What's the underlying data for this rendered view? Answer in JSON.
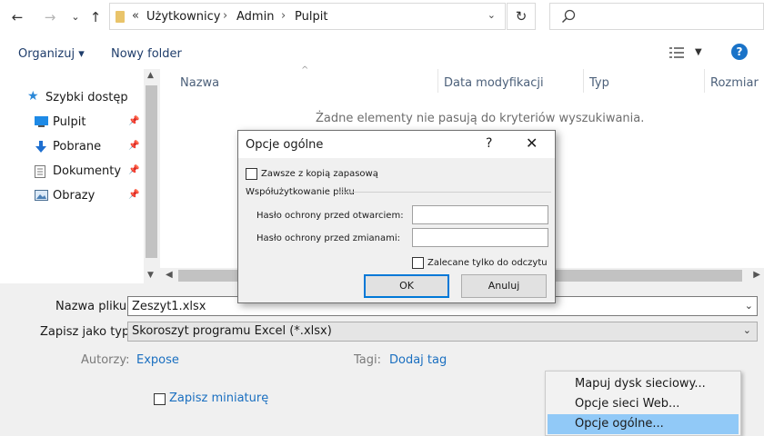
{
  "address": {
    "double_arrow": "«",
    "crumbs": [
      "Użytkownicy",
      "Admin",
      "Pulpit"
    ],
    "sep": "›",
    "dropdown": "⌄"
  },
  "toolbar": {
    "organize_label": "Organizuj",
    "organize_arrow": "▾",
    "new_folder_label": "Nowy folder",
    "help_label": "?"
  },
  "nav_pane": {
    "items": [
      {
        "label": "Szybki dostęp",
        "icon": "star-icon"
      },
      {
        "label": "Pulpit",
        "icon": "desktop-icon"
      },
      {
        "label": "Pobrane",
        "icon": "download-icon"
      },
      {
        "label": "Dokumenty",
        "icon": "document-icon"
      },
      {
        "label": "Obrazy",
        "icon": "pictures-icon"
      }
    ]
  },
  "file_list": {
    "columns": [
      "Nazwa",
      "Data modyfikacji",
      "Typ",
      "Rozmiar"
    ],
    "empty_message": "Żadne elementy nie pasują do kryteriów wyszukiwania."
  },
  "form": {
    "filename_label": "Nazwa pliku:",
    "filename_value": "Zeszyt1.xlsx",
    "type_label": "Zapisz jako typ:",
    "type_value": "Skoroszyt programu Excel (*.xlsx)",
    "authors_label": "Autorzy:",
    "authors_value": "Expose",
    "tags_label": "Tagi:",
    "tags_value": "Dodaj tag",
    "thumbnail_label": "Zapisz miniaturę"
  },
  "context_menu": {
    "items": [
      "Mapuj dysk sieciowy...",
      "Opcje sieci Web...",
      "Opcje ogólne..."
    ],
    "highlighted_index": 2
  },
  "dialog": {
    "title": "Opcje ogólne",
    "help": "?",
    "close": "✕",
    "backup_label": "Zawsze z kopią zapasową",
    "group_label": "Współużytkowanie pliku",
    "open_password_label": "Hasło ochrony przed otwarciem:",
    "modify_password_label": "Hasło ochrony przed zmianami:",
    "readonly_label": "Zalecane tylko do odczytu",
    "ok_label": "OK",
    "cancel_label": "Anuluj"
  },
  "colors": {
    "accent": "#0078d7",
    "link": "#1a6fc0",
    "menu_highlight": "#91c9f7"
  }
}
